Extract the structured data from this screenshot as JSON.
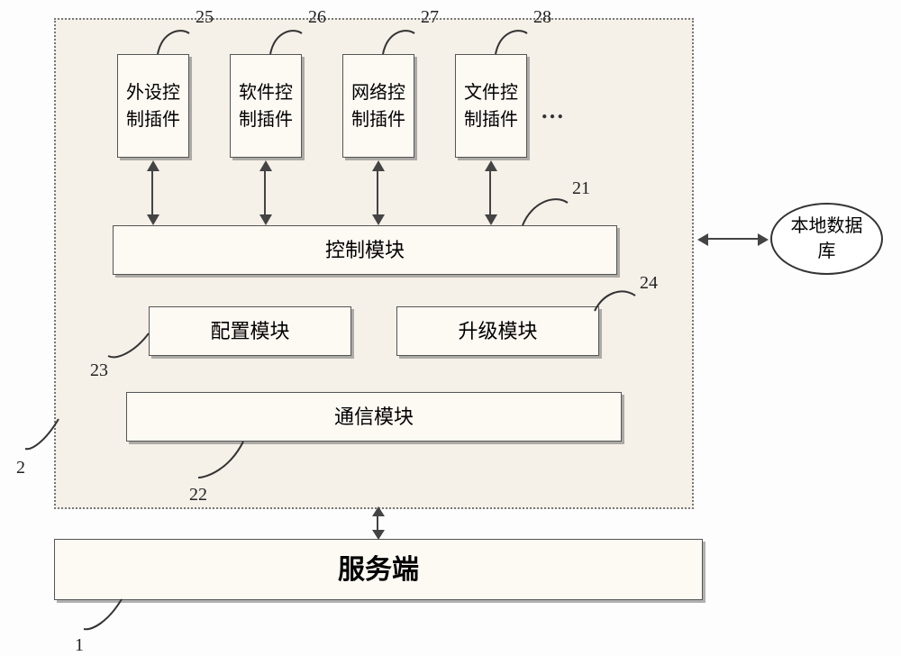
{
  "container_id": "2",
  "plugins": [
    {
      "label": "外设控\n制插件",
      "id": "25"
    },
    {
      "label": "软件控\n制插件",
      "id": "26"
    },
    {
      "label": "网络控\n制插件",
      "id": "27"
    },
    {
      "label": "文件控\n制插件",
      "id": "28"
    }
  ],
  "ellipsis": "…",
  "control_module": {
    "label": "控制模块",
    "id": "21"
  },
  "config_module": {
    "label": "配置模块",
    "id": "23"
  },
  "upgrade_module": {
    "label": "升级模块",
    "id": "24"
  },
  "comm_module": {
    "label": "通信模块",
    "id": "22"
  },
  "server": {
    "label": "服务端",
    "id": "1"
  },
  "database": {
    "label": "本地数据\n库"
  }
}
